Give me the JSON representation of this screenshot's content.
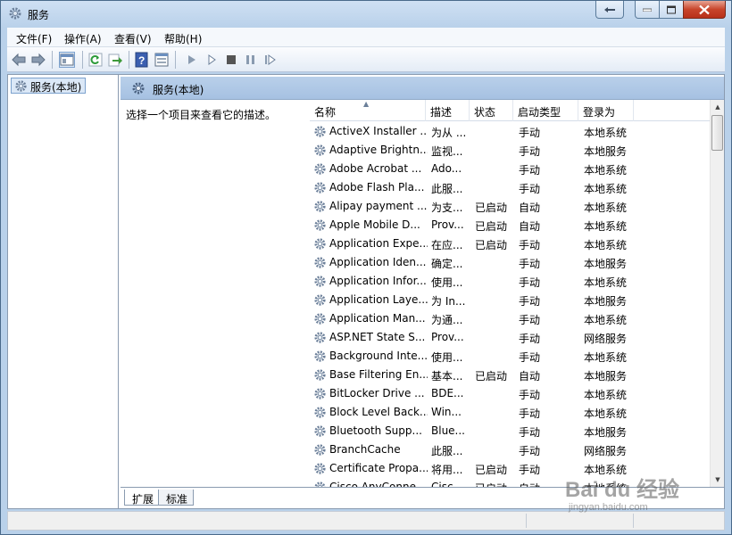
{
  "window": {
    "title": "服务"
  },
  "menu": [
    {
      "label": "文件(F)"
    },
    {
      "label": "操作(A)"
    },
    {
      "label": "查看(V)"
    },
    {
      "label": "帮助(H)"
    }
  ],
  "toolbar": {
    "icons": [
      "back-arrow-icon",
      "forward-arrow-icon",
      "console-tree-icon",
      "refresh-icon",
      "export-list-icon",
      "help-icon",
      "properties-icon",
      "start-service-icon",
      "start-service-alt-icon",
      "stop-service-icon",
      "pause-service-icon",
      "restart-service-icon"
    ]
  },
  "tree": {
    "selected_label": "服务(本地)"
  },
  "content": {
    "header_label": "服务(本地)",
    "description_hint": "选择一个项目来查看它的描述。"
  },
  "table": {
    "columns": [
      "名称",
      "描述",
      "状态",
      "启动类型",
      "登录为"
    ],
    "rows": [
      {
        "name": "ActiveX Installer ...",
        "desc": "为从 ...",
        "status": "",
        "startup": "手动",
        "logon": "本地系统"
      },
      {
        "name": "Adaptive Brightn...",
        "desc": "监视...",
        "status": "",
        "startup": "手动",
        "logon": "本地服务"
      },
      {
        "name": "Adobe Acrobat ...",
        "desc": "Ado...",
        "status": "",
        "startup": "手动",
        "logon": "本地系统"
      },
      {
        "name": "Adobe Flash Pla...",
        "desc": "此服...",
        "status": "",
        "startup": "手动",
        "logon": "本地系统"
      },
      {
        "name": "Alipay payment ...",
        "desc": "为支...",
        "status": "已启动",
        "startup": "自动",
        "logon": "本地系统"
      },
      {
        "name": "Apple Mobile D...",
        "desc": "Prov...",
        "status": "已启动",
        "startup": "自动",
        "logon": "本地系统"
      },
      {
        "name": "Application Expe...",
        "desc": "在应...",
        "status": "已启动",
        "startup": "手动",
        "logon": "本地系统"
      },
      {
        "name": "Application Iden...",
        "desc": "确定...",
        "status": "",
        "startup": "手动",
        "logon": "本地服务"
      },
      {
        "name": "Application Infor...",
        "desc": "使用...",
        "status": "",
        "startup": "手动",
        "logon": "本地系统"
      },
      {
        "name": "Application Laye...",
        "desc": "为 In...",
        "status": "",
        "startup": "手动",
        "logon": "本地服务"
      },
      {
        "name": "Application Man...",
        "desc": "为通...",
        "status": "",
        "startup": "手动",
        "logon": "本地系统"
      },
      {
        "name": "ASP.NET State S...",
        "desc": "Prov...",
        "status": "",
        "startup": "手动",
        "logon": "网络服务"
      },
      {
        "name": "Background Inte...",
        "desc": "使用...",
        "status": "",
        "startup": "手动",
        "logon": "本地系统"
      },
      {
        "name": "Base Filtering En...",
        "desc": "基本...",
        "status": "已启动",
        "startup": "自动",
        "logon": "本地服务"
      },
      {
        "name": "BitLocker Drive ...",
        "desc": "BDE...",
        "status": "",
        "startup": "手动",
        "logon": "本地系统"
      },
      {
        "name": "Block Level Back...",
        "desc": "Win...",
        "status": "",
        "startup": "手动",
        "logon": "本地系统"
      },
      {
        "name": "Bluetooth Supp...",
        "desc": "Blue...",
        "status": "",
        "startup": "手动",
        "logon": "本地服务"
      },
      {
        "name": "BranchCache",
        "desc": "此服...",
        "status": "",
        "startup": "手动",
        "logon": "网络服务"
      },
      {
        "name": "Certificate Propa...",
        "desc": "将用...",
        "status": "已启动",
        "startup": "手动",
        "logon": "本地系统"
      },
      {
        "name": "Cisco AnyConne...",
        "desc": "Cisc...",
        "status": "已启动",
        "startup": "自动",
        "logon": "本地系统"
      }
    ]
  },
  "tabs": [
    {
      "label": "扩展"
    },
    {
      "label": "标准"
    }
  ],
  "watermark": {
    "brand": "Bai du 经验",
    "url": "jingyan.baidu.com"
  }
}
